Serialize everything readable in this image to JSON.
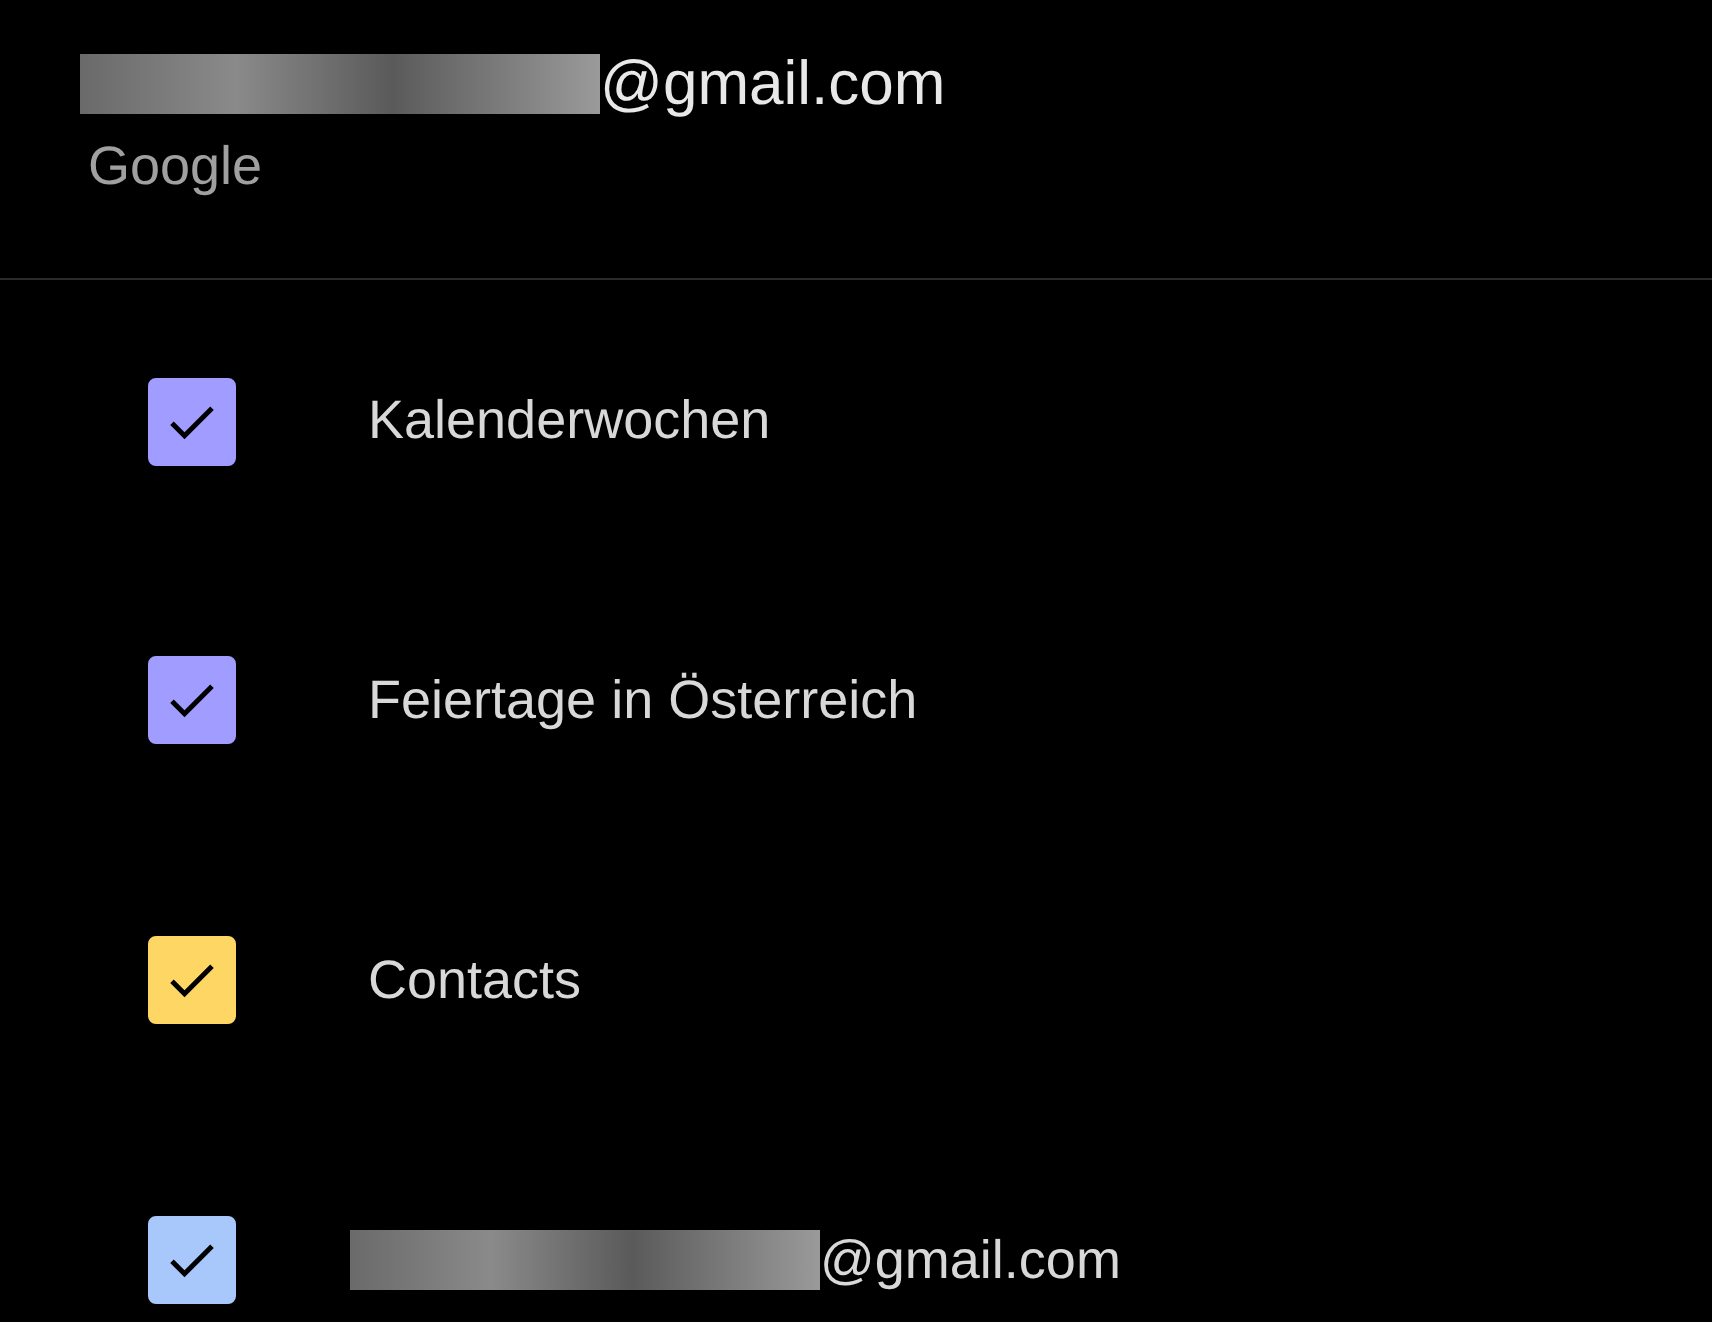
{
  "account": {
    "email": "@gmail.com",
    "provider": "Google"
  },
  "calendars": [
    {
      "kind": "plain",
      "label": "Kalenderwochen",
      "checked": true,
      "color": "#a19cff"
    },
    {
      "kind": "plain",
      "label": "Feiertage in Österreich",
      "checked": true,
      "color": "#a19cff"
    },
    {
      "kind": "plain",
      "label": "Contacts",
      "checked": true,
      "color": "#fdd663"
    },
    {
      "kind": "redacted",
      "label": "@gmail.com",
      "checked": true,
      "color": "#a8c7fa"
    }
  ]
}
